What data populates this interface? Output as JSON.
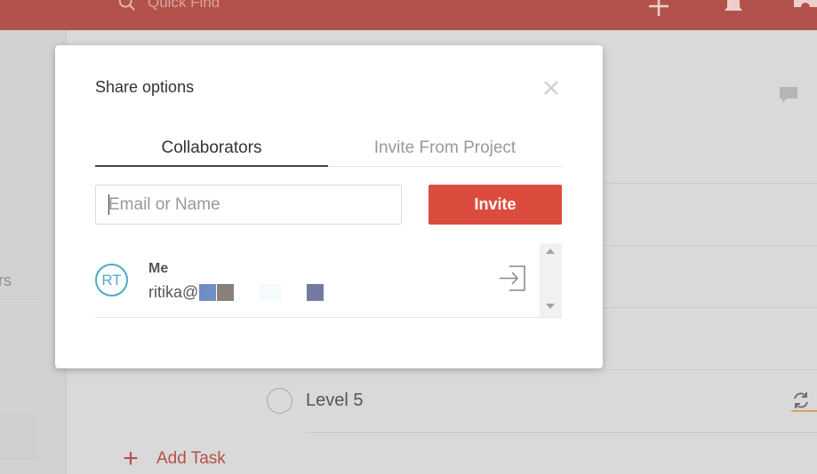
{
  "topbar": {
    "search_placeholder": "Quick Find",
    "icons": [
      "search-icon",
      "plus-icon",
      "bell-icon",
      "gift-icon"
    ],
    "color": "#b2524a"
  },
  "sidebar": {
    "partial_label": "rs"
  },
  "task_list": {
    "tasks": [
      {
        "label": "Level 5"
      }
    ],
    "add_task_label": "Add Task"
  },
  "modal": {
    "title": "Share options",
    "tabs": [
      {
        "label": "Collaborators",
        "active": true
      },
      {
        "label": "Invite From Project",
        "active": false
      }
    ],
    "email_input": {
      "placeholder": "Email or Name",
      "value": ""
    },
    "invite_button": "Invite",
    "collaborators": [
      {
        "initials": "RT",
        "name": "Me",
        "email_visible": "ritika@"
      }
    ],
    "colors": {
      "accent": "#db4c3f",
      "avatar": "#4fa8c8"
    }
  }
}
